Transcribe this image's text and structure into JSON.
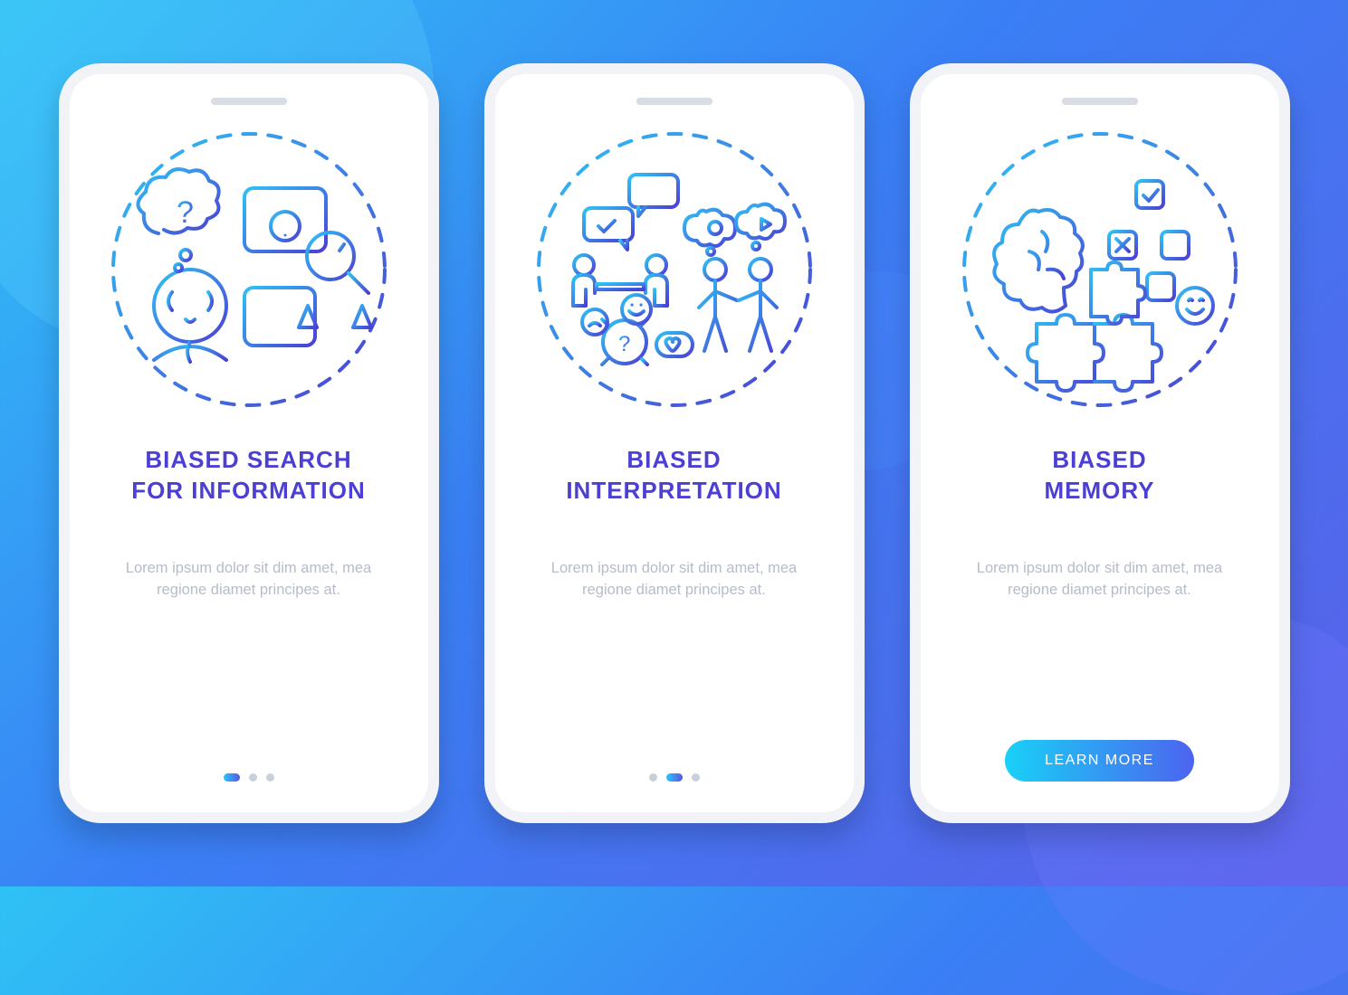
{
  "screens": [
    {
      "title": "BIASED SEARCH\nFOR INFORMATION",
      "description": "Lorem ipsum dolor sit dim amet, mea regione diamet principes at."
    },
    {
      "title": "BIASED\nINTERPRETATION",
      "description": "Lorem ipsum dolor sit dim amet, mea regione diamet principes at."
    },
    {
      "title": "BIASED\nMEMORY",
      "description": "Lorem ipsum dolor sit dim amet, mea regione diamet principes at."
    }
  ],
  "cta_label": "LEARN MORE",
  "colors": {
    "accent": "#4B3FD4",
    "muted": "#b6bcc9",
    "grad_start": "#18d1f7",
    "grad_end": "#4d63ef"
  }
}
